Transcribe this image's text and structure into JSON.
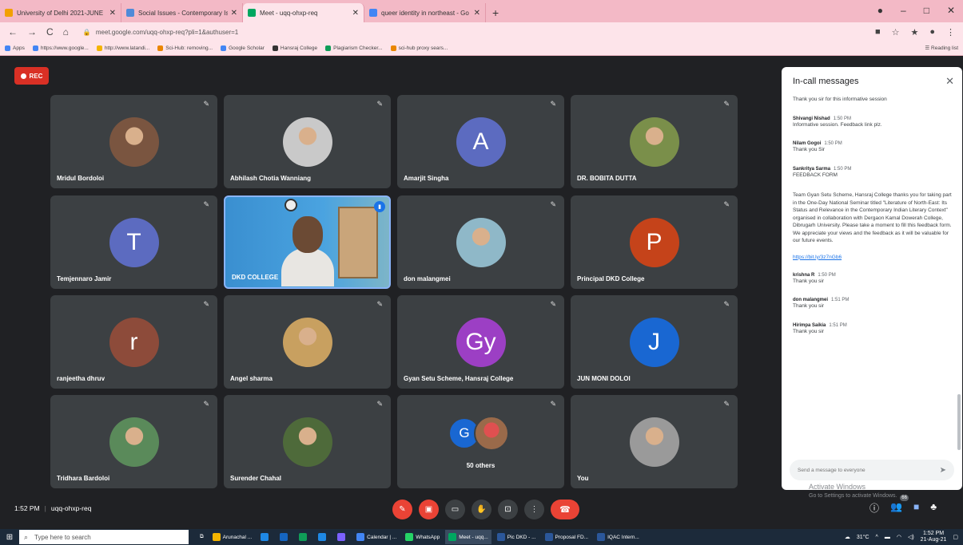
{
  "browser": {
    "tabs": [
      {
        "label": "University of Delhi 2021-JUNE",
        "color": "#f2a000",
        "active": false
      },
      {
        "label": "Social Issues - Contemporary Iss",
        "color": "#4f8ad8",
        "active": false
      },
      {
        "label": "Meet - uqq-ohxp-req",
        "color": "#00a760",
        "active": true
      },
      {
        "label": "queer identity in northeast - Go",
        "color": "#4285f4",
        "active": false
      }
    ],
    "url": "meet.google.com/uqq-ohxp-req?pli=1&authuser=1",
    "bookmarks": [
      {
        "label": "Apps",
        "color": "#4285f4"
      },
      {
        "label": "https://www.google...",
        "color": "#4285f4"
      },
      {
        "label": "http://www.latandi...",
        "color": "#f4b400"
      },
      {
        "label": "Sci-Hub: removing...",
        "color": "#ea8600"
      },
      {
        "label": "Google Scholar",
        "color": "#4285f4"
      },
      {
        "label": "Hansraj College",
        "color": "#333333"
      },
      {
        "label": "Plagiarism Checker...",
        "color": "#0f9d58"
      },
      {
        "label": "sci-hub proxy sears...",
        "color": "#ea8600"
      }
    ],
    "reading_list": "Reading list"
  },
  "meet": {
    "rec_label": "REC",
    "tiles": [
      {
        "name": "Mridul Bordoloi",
        "avatar_type": "photo",
        "color": "#7a5540"
      },
      {
        "name": "Abhilash Chotia Wanniang",
        "avatar_type": "photo",
        "color": "#c9c9c9"
      },
      {
        "name": "Amarjit Singha",
        "avatar_type": "letter",
        "letter": "A",
        "color": "#5c6bc0"
      },
      {
        "name": "DR. BOBITA DUTTA",
        "avatar_type": "photo",
        "color": "#7a8f4a"
      },
      {
        "name": "Temjennaro Jamir",
        "avatar_type": "letter",
        "letter": "T",
        "color": "#5c6bc0"
      },
      {
        "name": "DKD COLLEGE",
        "avatar_type": "video",
        "color": "#3a8fd0"
      },
      {
        "name": "don malangmei",
        "avatar_type": "photo",
        "color": "#8fb8c8"
      },
      {
        "name": "Principal DKD College",
        "avatar_type": "letter",
        "letter": "P",
        "color": "#c5431a"
      },
      {
        "name": "ranjeetha dhruv",
        "avatar_type": "letter",
        "letter": "r",
        "color": "#8d4b3a"
      },
      {
        "name": "Angel sharma",
        "avatar_type": "photo",
        "color": "#c8a060"
      },
      {
        "name": "Gyan Setu Scheme, Hansraj College",
        "avatar_type": "letter",
        "letter": "Gy",
        "color": "#9c3fc4"
      },
      {
        "name": "JUN MONI DOLOI",
        "avatar_type": "letter",
        "letter": "J",
        "color": "#1967d2"
      },
      {
        "name": "Tridhara Bardoloi",
        "avatar_type": "photo",
        "color": "#5a8a5a"
      },
      {
        "name": "Surender Chahal",
        "avatar_type": "photo",
        "color": "#4e6a3a"
      },
      {
        "name": "50 others",
        "avatar_type": "others",
        "letter": "G",
        "color": "#1967d2"
      },
      {
        "name": "You",
        "avatar_type": "photo",
        "color": "#9a9a9a"
      }
    ],
    "time": "1:52 PM",
    "meeting_code": "uqq-ohxp-req",
    "participants_badge": "66"
  },
  "chat": {
    "title": "In-call messages",
    "top_text": "Thank you sir for this informative session",
    "messages": [
      {
        "sender": "Shivangi Nishad",
        "time": "1:50 PM",
        "text": "Informative session. Feedback link plz."
      },
      {
        "sender": "Nilam Gogoi",
        "time": "1:50 PM",
        "text": "Thank you Sir"
      },
      {
        "sender": "Sankritya Sarma",
        "time": "1:50 PM",
        "text": "FEEDBACK FORM",
        "long": "Team Gyan Setu Scheme, Hansraj College thanks you for taking part in the One-Day National Seminar titled \"Literature of North-East: Its Status and Relevance in the Contemporary Indian Literary Context\" organised in collaboration with Dergaon Kamal Dowerah College, Dibrugarh University. Please take a moment to fill this feedback form. We appreciate your views and the feedback as it will be valuable for our future events.",
        "link": "https://bit.ly/3z7nGb6"
      },
      {
        "sender": "krishna R",
        "time": "1:50 PM",
        "text": "Thank you sir"
      },
      {
        "sender": "don malangmei",
        "time": "1:51 PM",
        "text": "Thank you sir"
      },
      {
        "sender": "Hirimpa Saikia",
        "time": "1:51 PM",
        "text": "Thank you sir"
      }
    ],
    "input_placeholder": "Send a message to everyone"
  },
  "watermark": {
    "line1": "Activate Windows",
    "line2": "Go to Settings to activate Windows."
  },
  "taskbar": {
    "search_placeholder": "Type here to search",
    "tasks": [
      {
        "label": "Arunachal ...",
        "color": "#f4b400"
      },
      {
        "label": "",
        "color": "#1e88e5"
      },
      {
        "label": "",
        "color": "#1565c0"
      },
      {
        "label": "",
        "color": "#0f9d58"
      },
      {
        "label": "",
        "color": "#1e88e5"
      },
      {
        "label": "",
        "color": "#7b61ff"
      },
      {
        "label": "Calendar | ...",
        "color": "#4285f4"
      },
      {
        "label": "WhatsApp",
        "color": "#25d366"
      },
      {
        "label": "Meet - uqq...",
        "color": "#00a760"
      },
      {
        "label": "Pic DKD - ...",
        "color": "#2b579a"
      },
      {
        "label": "Proposal FD...",
        "color": "#2b579a"
      },
      {
        "label": "IQAC Intern...",
        "color": "#2b579a"
      }
    ],
    "temp": "31°C",
    "clock_time": "1:52 PM",
    "clock_date": "21-Aug-21"
  }
}
